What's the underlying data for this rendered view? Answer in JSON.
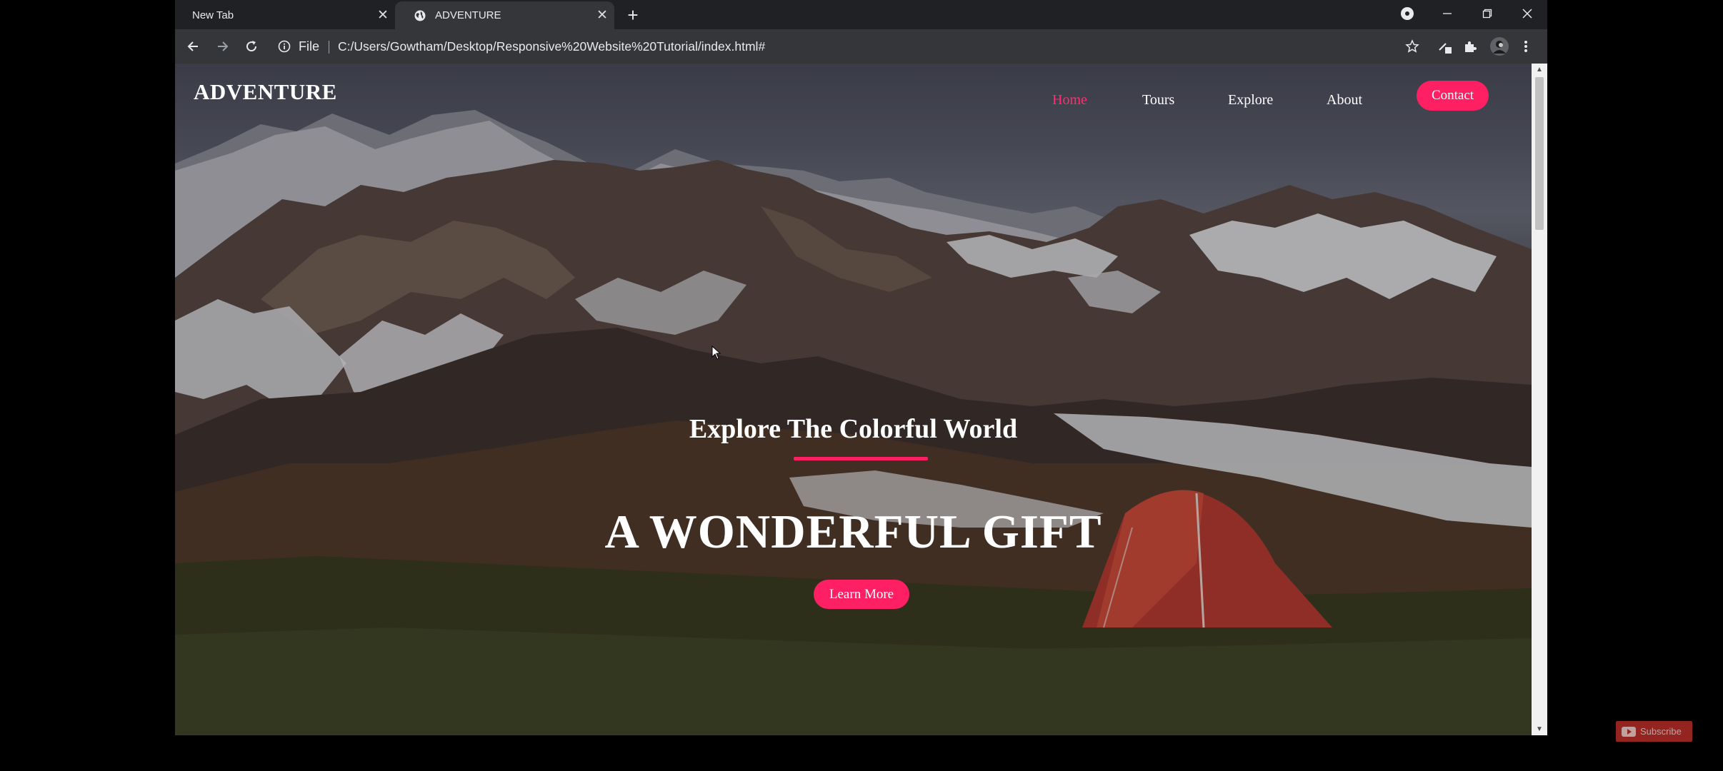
{
  "browser": {
    "tabs": [
      {
        "title": "New Tab",
        "active": false
      },
      {
        "title": "ADVENTURE",
        "active": true
      }
    ],
    "address": {
      "scheme_label": "File",
      "url": "C:/Users/Gowtham/Desktop/Responsive%20Website%20Tutorial/index.html#"
    },
    "icons": {
      "back": "arrow-left-icon",
      "forward": "arrow-right-icon",
      "reload": "reload-icon",
      "info": "info-icon",
      "bookmark": "star-icon",
      "extensions": "puzzle-icon",
      "profile": "avatar",
      "menu": "kebab-menu-icon"
    }
  },
  "page": {
    "logo": "ADVENTURE",
    "nav": [
      "Home",
      "Tours",
      "Explore",
      "About"
    ],
    "contact": "Contact",
    "hero_subtitle": "Explore The Colorful World",
    "hero_title": "A WONDERFUL GIFT",
    "hero_button": "Learn More"
  },
  "overlay": {
    "subscribe": "Subscribe"
  },
  "colors": {
    "accent": "#ff1f63",
    "chrome_dark": "#202124",
    "chrome_toolbar": "#35363a"
  }
}
